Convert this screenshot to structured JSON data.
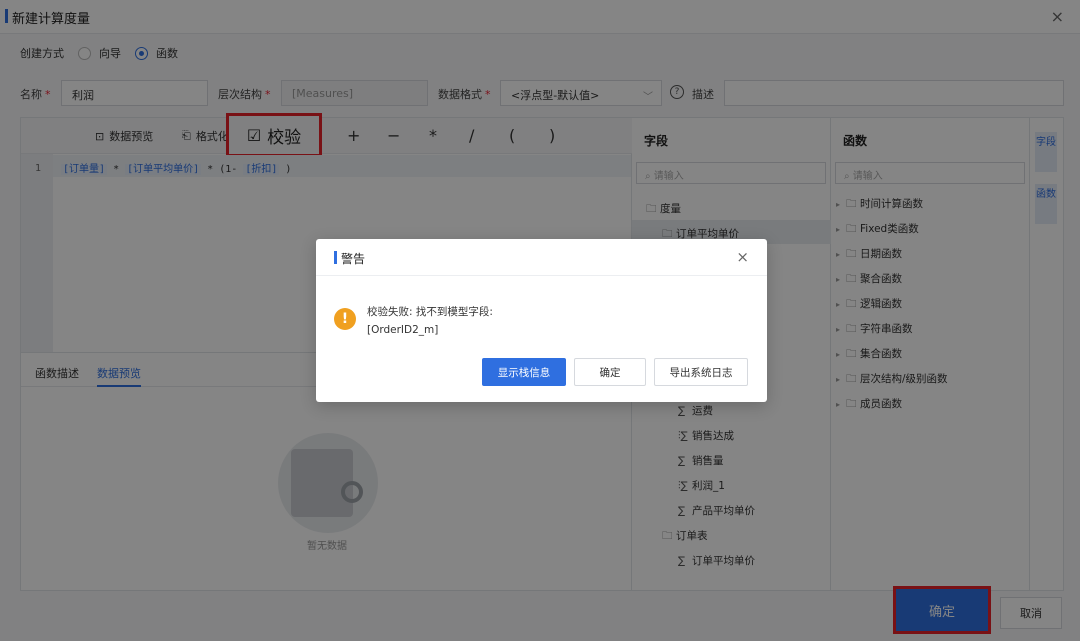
{
  "dialog": {
    "title": "新建计算度量",
    "close_label": "×"
  },
  "create_mode": {
    "label": "创建方式",
    "options": [
      "向导",
      "函数"
    ],
    "selected": "函数"
  },
  "form": {
    "name_label": "名称",
    "name_value": "利润",
    "hierarchy_label": "层次结构",
    "hierarchy_value": "[Measures]",
    "format_label": "数据格式",
    "format_value": "<浮点型-默认值>",
    "desc_label": "描述",
    "desc_value": "",
    "required_mark": "*"
  },
  "toolbar": {
    "preview_label": "数据预览",
    "format_label": "格式化",
    "validate_label": "校验",
    "operators": [
      "+",
      "−",
      "*",
      "/",
      "(",
      ")"
    ]
  },
  "editor": {
    "line_number": "1",
    "tokens": [
      {
        "type": "field",
        "text": "[订单量]"
      },
      {
        "type": "op",
        "text": " * "
      },
      {
        "type": "field",
        "text": "[订单平均单价]"
      },
      {
        "type": "op",
        "text": " * (1- "
      },
      {
        "type": "field",
        "text": "[折扣]"
      },
      {
        "type": "op",
        "text": " )"
      }
    ]
  },
  "desc_tabs": {
    "tab1": "函数描述",
    "tab2": "数据预览",
    "active": "数据预览",
    "empty_text": "暂无数据"
  },
  "fields": {
    "header": "字段",
    "search_placeholder": "请输入",
    "items_top": [
      {
        "label": "度量",
        "kind": "folder"
      },
      {
        "label": "订单平均单价",
        "kind": "folder",
        "selected": true
      }
    ],
    "items_bottom": [
      {
        "label": "运费",
        "kind": "sigma"
      },
      {
        "label": "销售达成",
        "kind": "calc"
      },
      {
        "label": "销售量",
        "kind": "sigma"
      },
      {
        "label": "利润_1",
        "kind": "calc"
      },
      {
        "label": "产品平均单价",
        "kind": "sigma"
      },
      {
        "label": "订单表",
        "kind": "folder"
      },
      {
        "label": "订单平均单价",
        "kind": "sigma"
      }
    ]
  },
  "functions": {
    "header": "函数",
    "search_placeholder": "请输入",
    "groups": [
      "时间计算函数",
      "Fixed类函数",
      "日期函数",
      "聚合函数",
      "逻辑函数",
      "字符串函数",
      "集合函数",
      "层次结构/级别函数",
      "成员函数"
    ]
  },
  "side_tabs": [
    "字段",
    "函数"
  ],
  "footer": {
    "ok_label": "确定",
    "cancel_label": "取消"
  },
  "alert": {
    "title": "警告",
    "message_line1": "校验失败: 找不到模型字段:",
    "message_line2": "[OrderID2_m]",
    "btn_stack": "显示栈信息",
    "btn_ok": "确定",
    "btn_export": "导出系统日志",
    "close_label": "×"
  },
  "colors": {
    "primary": "#2f6fe0",
    "highlight_border": "#e8222a",
    "warning": "#f0a020"
  }
}
